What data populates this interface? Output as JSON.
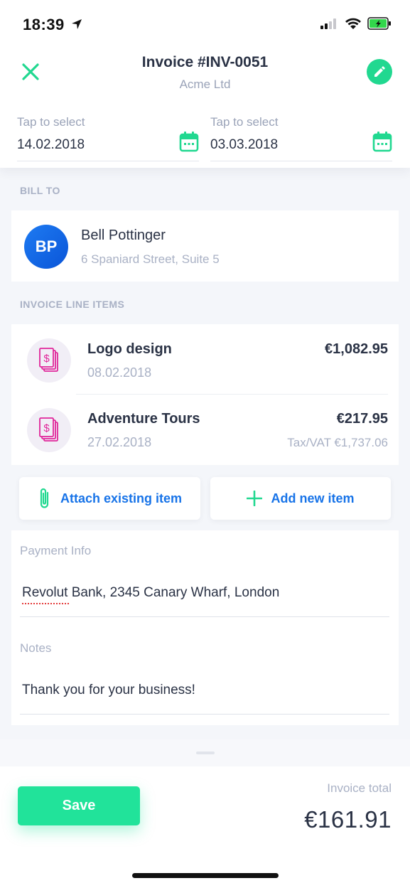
{
  "status_bar": {
    "time": "18:39"
  },
  "header": {
    "title": "Invoice #INV-0051",
    "subtitle": "Acme Ltd",
    "start_date": {
      "label": "Tap to select",
      "value": "14.02.2018"
    },
    "due_date": {
      "label": "Tap to select",
      "value": "03.03.2018"
    }
  },
  "bill_to": {
    "section_title": "BILL TO",
    "client": {
      "initials": "BP",
      "name": "Bell Pottinger",
      "address": "6 Spaniard Street, Suite 5"
    }
  },
  "line_items": {
    "section_title": "INVOICE LINE ITEMS",
    "items": [
      {
        "name": "Logo design",
        "date": "08.02.2018",
        "amount": "€1,082.95",
        "tax": ""
      },
      {
        "name": "Adventure Tours",
        "date": "27.02.2018",
        "amount": "€217.95",
        "tax": "Tax/VAT €1,737.06"
      }
    ],
    "attach_label": "Attach existing item",
    "add_label": "Add new item"
  },
  "payment": {
    "label": "Payment Info",
    "value": "Revolut Bank, 2345 Canary Wharf, London"
  },
  "notes": {
    "label": "Notes",
    "value": "Thank you for your business!"
  },
  "footer": {
    "save_label": "Save",
    "total_label": "Invoice total",
    "total_value": "€161.91"
  },
  "colors": {
    "accent_green": "#21d890",
    "link_blue": "#1773e8",
    "invoice_pink": "#e0269a"
  },
  "icons": [
    "location-arrow-icon",
    "signal-icon",
    "wifi-icon",
    "battery-icon",
    "close-icon",
    "pencil-icon",
    "calendar-icon",
    "invoice-dollar-icon",
    "paperclip-icon",
    "plus-icon"
  ]
}
